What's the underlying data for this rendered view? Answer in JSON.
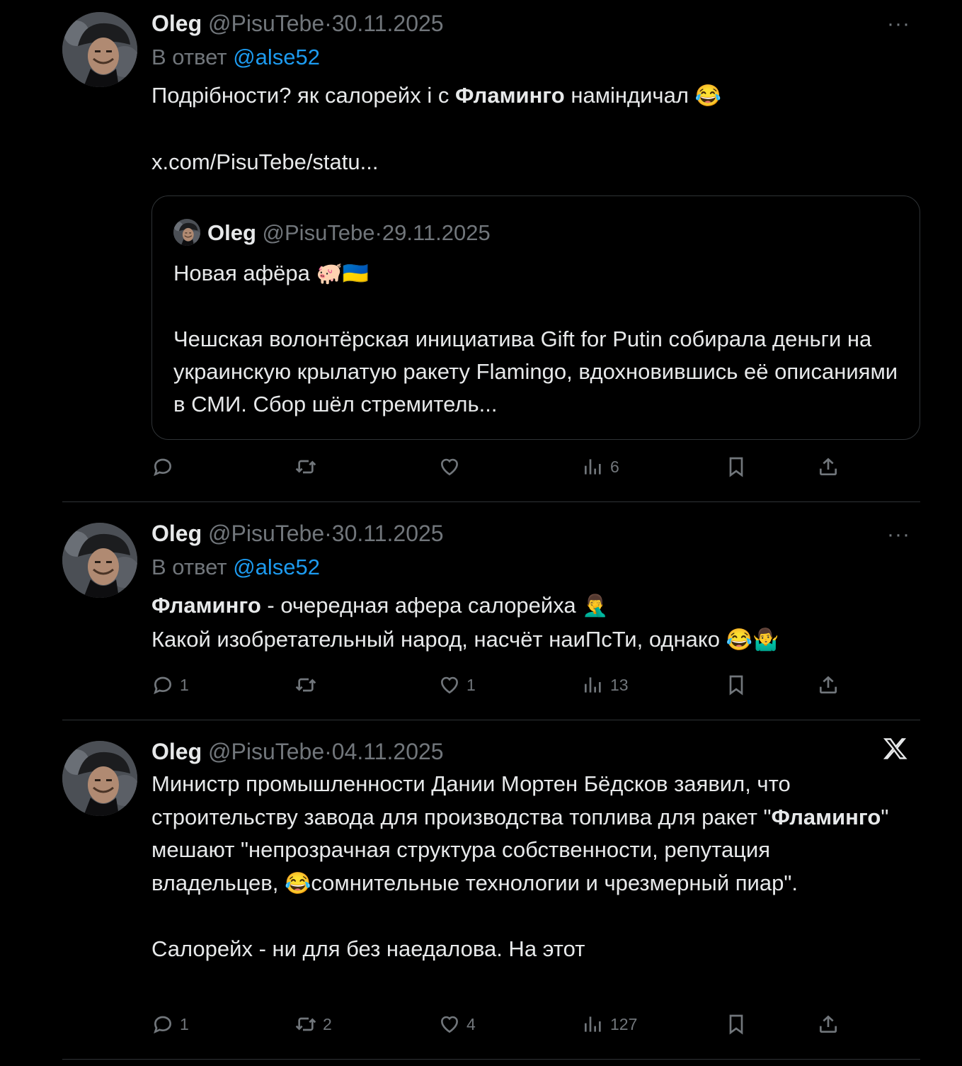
{
  "tweets": [
    {
      "name": "Oleg",
      "handle": "@PisuTebe",
      "dot": "·",
      "date": "30.11.2025",
      "reply_prefix": "В ответ",
      "reply_to": "@alse52",
      "text_a": "Подрібности? як салорейх і с ",
      "text_bold": "Фламинго",
      "text_b": " наміндичал ",
      "emoji_1": "😂",
      "link": "x.com/PisuTebe/statu...",
      "more": "···",
      "quote": {
        "name": "Oleg",
        "handle": "@PisuTebe",
        "dot": "·",
        "date": "29.11.2025",
        "line1": "Новая афёра ",
        "emoji": "🐖🇺🇦",
        "para": "Чешская волонтёрская инициатива Gift for Putin собирала деньги на украинскую крылатую ракету Flamingo, вдохновившись её описаниями в СМИ. Сбор шёл стремитель..."
      },
      "actions": {
        "replies": "",
        "reposts": "",
        "likes": "",
        "views": "6"
      }
    },
    {
      "name": "Oleg",
      "handle": "@PisuTebe",
      "dot": "·",
      "date": "30.11.2025",
      "reply_prefix": "В ответ",
      "reply_to": "@alse52",
      "line1_bold": "Фламинго",
      "line1_rest": " - очередная афера салорейха ",
      "emoji_1": "🤦‍♂️",
      "line2": "Какой изобретательный народ, насчёт наиПсТи, однако ",
      "emoji_2": "😂🤷‍♂️",
      "more": "···",
      "actions": {
        "replies": "1",
        "reposts": "",
        "likes": "1",
        "views": "13"
      }
    },
    {
      "name": "Oleg",
      "handle": "@PisuTebe",
      "dot": "·",
      "date": "04.11.2025",
      "p1_a": "Министр промышленности Дании Мортен Бёдсков заявил, что строительству завода для производства топлива для ракет \"",
      "p1_bold": "Фламинго",
      "p1_b": "\" мешают \"непрозрачная структура собственности, репутация владельцев, ",
      "emoji_1": "😂",
      "p1_c": "сомнительные технологии и чрезмерный пиар\".",
      "p2": "Салорейх - ни для без наедалова. На этот",
      "actions": {
        "replies": "1",
        "reposts": "2",
        "likes": "4",
        "views": "127"
      }
    }
  ],
  "icons": [
    "reply-icon",
    "repost-icon",
    "like-icon",
    "views-icon",
    "bookmark-icon",
    "share-icon",
    "x-logo-icon",
    "more-icon"
  ],
  "colors": {
    "background": "#000000",
    "text": "#e7e9ea",
    "muted": "#71767b",
    "link": "#1d9bf0",
    "border": "#2f3336"
  }
}
